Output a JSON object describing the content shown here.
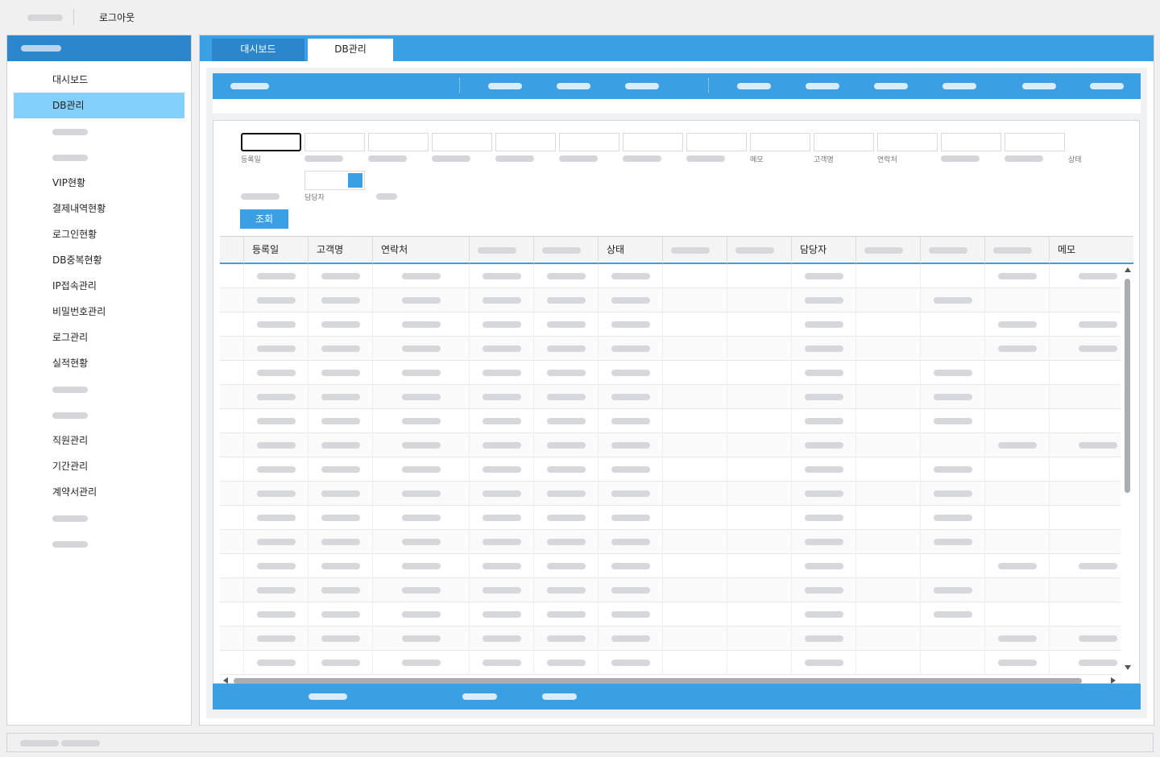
{
  "header": {
    "logout_label": "로그아웃"
  },
  "sidebar": {
    "items": [
      {
        "label": "대시보드",
        "active": false
      },
      {
        "label": "DB관리",
        "active": true
      },
      {
        "label": "",
        "active": false
      },
      {
        "label": "",
        "active": false
      },
      {
        "label": "VIP현황",
        "active": false
      },
      {
        "label": "결제내역현황",
        "active": false
      },
      {
        "label": "로그인현황",
        "active": false
      },
      {
        "label": "DB중복현황",
        "active": false
      },
      {
        "label": "IP접속관리",
        "active": false
      },
      {
        "label": "비밀번호관리",
        "active": false
      },
      {
        "label": "로그관리",
        "active": false
      },
      {
        "label": "실적현황",
        "active": false
      },
      {
        "label": "",
        "active": false
      },
      {
        "label": "",
        "active": false
      },
      {
        "label": "직원관리",
        "active": false
      },
      {
        "label": "기간관리",
        "active": false
      },
      {
        "label": "계약서관리",
        "active": false
      },
      {
        "label": "",
        "active": false
      },
      {
        "label": "",
        "active": false
      }
    ]
  },
  "tabs": [
    {
      "label": "대시보드",
      "active": false
    },
    {
      "label": "DB관리",
      "active": true
    }
  ],
  "filters": {
    "row1_labels": [
      "등록일",
      "",
      "",
      "",
      "",
      "",
      "",
      "",
      "메모",
      "고객명",
      "연락처",
      "",
      "",
      "상태"
    ],
    "row2_labels": [
      "",
      "담당자",
      ""
    ],
    "search_button": "조회"
  },
  "grid": {
    "columns": [
      "",
      "등록일",
      "고객명",
      "연락처",
      "",
      "",
      "상태",
      "",
      "",
      "담당자",
      "",
      "",
      "",
      "메모"
    ],
    "row_count": 17
  },
  "colors": {
    "primary": "#3a9fe3",
    "primary_dark": "#2b86cc",
    "active_menu": "#82d0fb"
  }
}
